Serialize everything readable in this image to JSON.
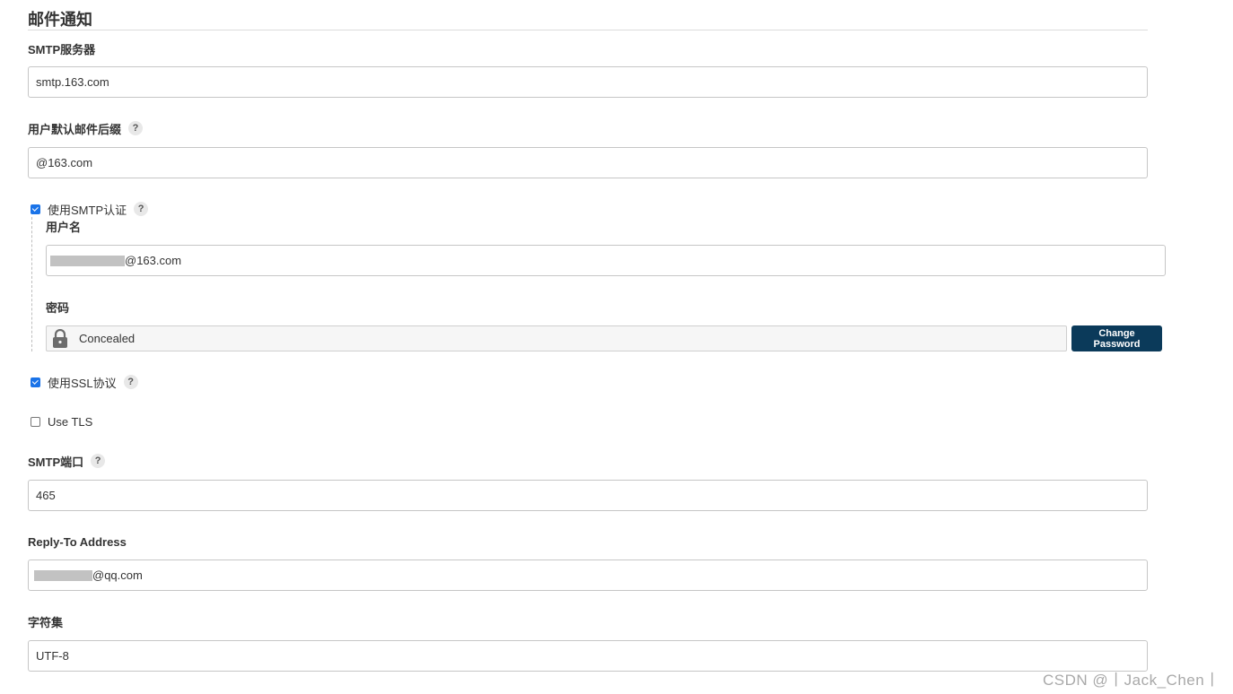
{
  "section": {
    "title": "邮件通知"
  },
  "smtp_server": {
    "label": "SMTP服务器",
    "value": "smtp.163.com"
  },
  "default_suffix": {
    "label": "用户默认邮件后缀",
    "value": "@163.com"
  },
  "smtp_auth": {
    "label": "使用SMTP认证",
    "checked": true,
    "username": {
      "label": "用户名",
      "value_suffix": "@163.com"
    },
    "password": {
      "label": "密码",
      "value": "Concealed",
      "button_label": "Change Password"
    }
  },
  "use_ssl": {
    "label": "使用SSL协议",
    "checked": true
  },
  "use_tls": {
    "label": "Use TLS",
    "checked": false
  },
  "smtp_port": {
    "label": "SMTP端口",
    "value": "465"
  },
  "reply_to": {
    "label": "Reply-To Address",
    "value_suffix": "@qq.com"
  },
  "charset": {
    "label": "字符集",
    "value": "UTF-8"
  },
  "help_glyph": "?",
  "watermark": "CSDN @丨Jack_Chen丨",
  "icons": {
    "help": "question-icon",
    "lock": "lock-icon"
  },
  "colors": {
    "checkbox": "#1a73e8",
    "button": "#0b3a5a"
  }
}
